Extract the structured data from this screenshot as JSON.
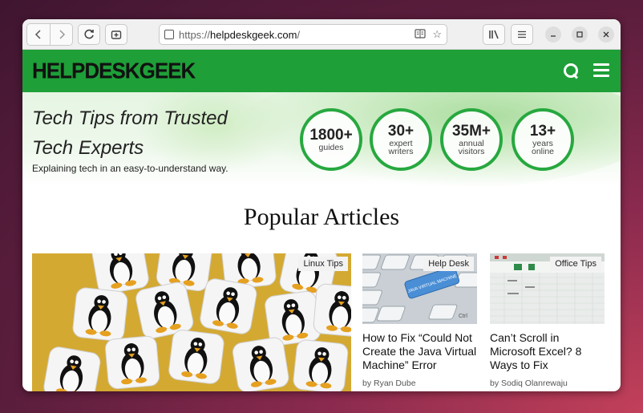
{
  "browser": {
    "url_prefix": "https://",
    "url_domain": "helpdeskgeek.com",
    "url_path": "/",
    "back_icon": "chevron-left-icon",
    "forward_icon": "chevron-right-icon",
    "reload_icon": "reload-icon",
    "new_tab_icon": "new-tab-icon",
    "library_icon": "library-icon",
    "menu_icon": "hamburger-icon"
  },
  "site": {
    "logo_part1": "HELP",
    "logo_part2": "DESK",
    "logo_part3": "GEEK",
    "brand_color": "#1e9f38"
  },
  "hero": {
    "title_line1": "Tech Tips from Trusted",
    "title_line2": "Tech Experts",
    "subtitle": "Explaining tech in an easy-to-understand way.",
    "stats": [
      {
        "num": "1800+",
        "label1": "guides",
        "label2": ""
      },
      {
        "num": "30+",
        "label1": "expert",
        "label2": "writers"
      },
      {
        "num": "35M+",
        "label1": "annual",
        "label2": "visitors"
      },
      {
        "num": "13+",
        "label1": "years",
        "label2": "online"
      }
    ]
  },
  "popular": {
    "heading": "Popular Articles",
    "big_card": {
      "tag": "Linux Tips"
    },
    "cards": [
      {
        "tag": "Help Desk",
        "title": "How to Fix “Could Not Create the Java Virtual Machine” Error",
        "author": "by Ryan Dube",
        "key_text": "JAVA VIRTUAL MACHINE"
      },
      {
        "tag": "Office Tips",
        "title": "Can’t Scroll in Microsoft Excel? 8 Ways to Fix",
        "author": "by Sodiq Olanrewaju"
      }
    ]
  }
}
